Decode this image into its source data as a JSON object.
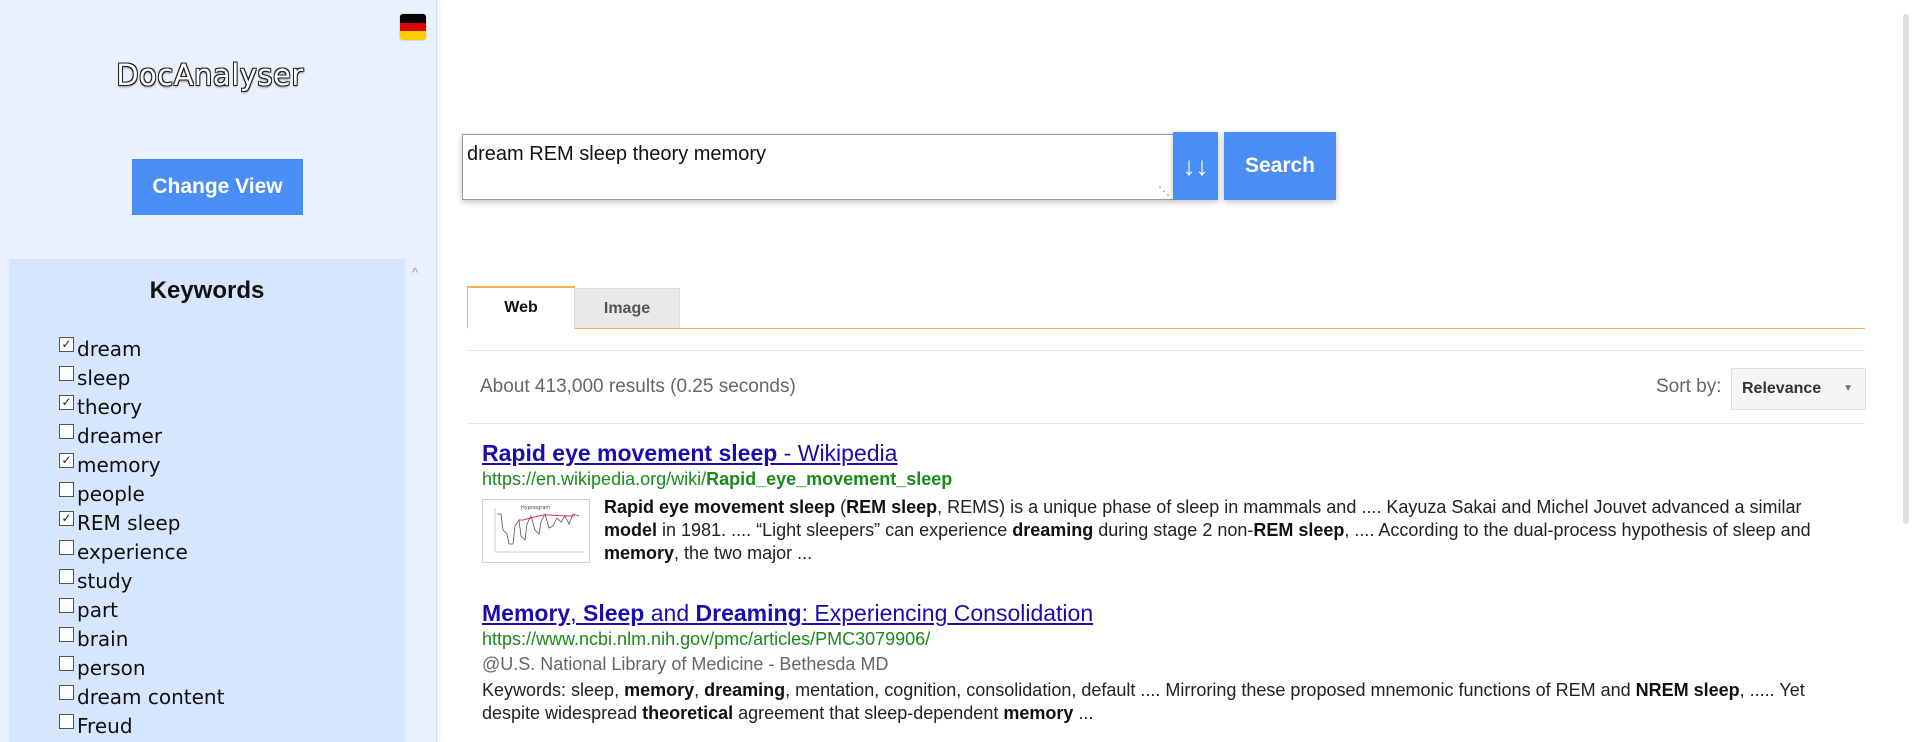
{
  "sidebar": {
    "app_title": "DocAnalyser",
    "change_view_label": "Change View",
    "flag_icon": "germany-flag-icon",
    "keywords": {
      "title": "Keywords",
      "items": [
        {
          "label": "dream",
          "checked": true
        },
        {
          "label": "sleep",
          "checked": false
        },
        {
          "label": "theory",
          "checked": true
        },
        {
          "label": "dreamer",
          "checked": false
        },
        {
          "label": "memory",
          "checked": true
        },
        {
          "label": "people",
          "checked": false
        },
        {
          "label": "REM sleep",
          "checked": true
        },
        {
          "label": "experience",
          "checked": false
        },
        {
          "label": "study",
          "checked": false
        },
        {
          "label": "part",
          "checked": false
        },
        {
          "label": "brain",
          "checked": false
        },
        {
          "label": "person",
          "checked": false
        },
        {
          "label": "dream content",
          "checked": false
        },
        {
          "label": "Freud",
          "checked": false
        }
      ]
    }
  },
  "search": {
    "query": "dream REM sleep theory memory",
    "sort_toggle_label": "↓↓",
    "search_label": "Search"
  },
  "tabs": [
    {
      "label": "Web",
      "active": true
    },
    {
      "label": "Image",
      "active": false
    }
  ],
  "results_info": {
    "stats": "About 413,000 results (0.25 seconds)",
    "sort_label": "Sort by:",
    "sort_value": "Relevance"
  },
  "results": [
    {
      "title_bold": "Rapid eye movement sleep",
      "title_rest": " - Wikipedia",
      "url_prefix": "https://en.wikipedia.org/wiki/",
      "url_bold": "Rapid_eye_movement_sleep",
      "thumbnail_icon": "hypnogram-thumbnail",
      "snippet": [
        {
          "t": "Rapid eye movement sleep",
          "b": true
        },
        {
          "t": " (",
          "b": false
        },
        {
          "t": "REM sleep",
          "b": true
        },
        {
          "t": ", REMS) is a unique phase of sleep in mammals and .... Kayuza Sakai and Michel Jouvet advanced a similar ",
          "b": false
        },
        {
          "t": "model",
          "b": true
        },
        {
          "t": " in 1981. .... “Light sleepers” can experience ",
          "b": false
        },
        {
          "t": "dreaming",
          "b": true
        },
        {
          "t": " during stage 2 non-",
          "b": false
        },
        {
          "t": "REM sleep",
          "b": true
        },
        {
          "t": ", .... According to the dual-process hypothesis of sleep and ",
          "b": false
        },
        {
          "t": "memory",
          "b": true
        },
        {
          "t": ", the two major ...",
          "b": false
        }
      ]
    },
    {
      "title_parts": [
        {
          "t": "Memory",
          "b": true
        },
        {
          "t": ", ",
          "b": false
        },
        {
          "t": "Sleep",
          "b": true
        },
        {
          "t": " and ",
          "b": false
        },
        {
          "t": "Dreaming",
          "b": true
        },
        {
          "t": ": Experiencing Consolidation",
          "b": false
        }
      ],
      "url": "https://www.ncbi.nlm.nih.gov/pmc/articles/PMC3079906/",
      "source": "@U.S. National Library of Medicine - Bethesda MD",
      "snippet": [
        {
          "t": "Keywords: sleep, ",
          "b": false
        },
        {
          "t": "memory",
          "b": true
        },
        {
          "t": ", ",
          "b": false
        },
        {
          "t": "dreaming",
          "b": true
        },
        {
          "t": ", mentation, cognition, consolidation, default .... Mirroring these proposed mnemonic functions of REM and ",
          "b": false
        },
        {
          "t": "NREM sleep",
          "b": true
        },
        {
          "t": ", ..... Yet despite widespread ",
          "b": false
        },
        {
          "t": "theoretical",
          "b": true
        },
        {
          "t": " agreement that sleep-dependent ",
          "b": false
        },
        {
          "t": "memory",
          "b": true
        },
        {
          "t": " ...",
          "b": false
        }
      ]
    }
  ],
  "colors": {
    "accent": "#4a8ef5",
    "sidebar_bg": "#e8f1fd",
    "keywords_bg": "#d5e6fd",
    "tab_accent": "#f4b342",
    "link": "#1a0dab",
    "url": "#1a8a1a"
  }
}
